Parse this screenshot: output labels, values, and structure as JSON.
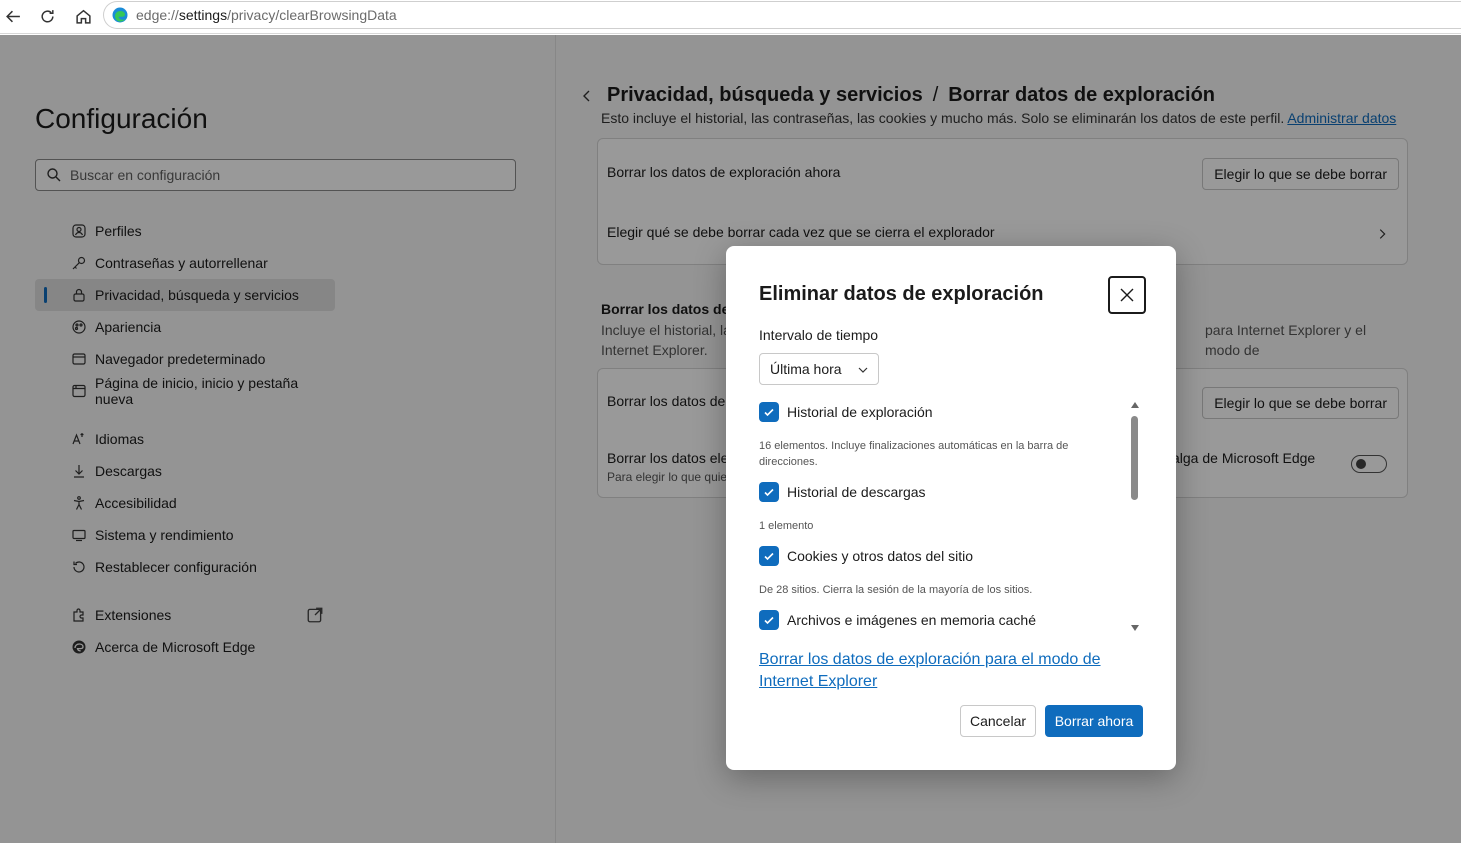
{
  "browser": {
    "url_prefix": "edge://",
    "url_host": "settings",
    "url_path": "/privacy/clearBrowsingData"
  },
  "sidebar": {
    "title": "Configuración",
    "search_placeholder": "Buscar en configuración",
    "items": [
      {
        "label": "Perfiles",
        "icon": "profile-icon"
      },
      {
        "label": "Contraseñas y autorrellenar",
        "icon": "key-icon"
      },
      {
        "label": "Privacidad, búsqueda y servicios",
        "icon": "lock-icon",
        "active": true
      },
      {
        "label": "Apariencia",
        "icon": "appearance-icon"
      },
      {
        "label": "Navegador predeterminado",
        "icon": "browser-icon"
      },
      {
        "label": "Página de inicio, inicio y pestaña nueva",
        "icon": "home-page-icon"
      },
      {
        "label": "Idiomas",
        "icon": "languages-icon"
      },
      {
        "label": "Descargas",
        "icon": "download-icon"
      },
      {
        "label": "Accesibilidad",
        "icon": "accessibility-icon"
      },
      {
        "label": "Sistema y rendimiento",
        "icon": "system-icon"
      },
      {
        "label": "Restablecer configuración",
        "icon": "reset-icon"
      },
      {
        "label": "Extensiones",
        "icon": "extensions-icon"
      },
      {
        "label": "Acerca de Microsoft Edge",
        "icon": "edge-icon"
      }
    ]
  },
  "main": {
    "breadcrumb_parent": "Privacidad, búsqueda y servicios",
    "breadcrumb_sep": "/",
    "breadcrumb_current": "Borrar datos de exploración",
    "description": "Esto incluye el historial, las contraseñas, las cookies y mucho más. Solo se eliminarán los datos de este perfil.",
    "manage_link": "Administrar datos",
    "card1_row1": "Borrar los datos de exploración ahora",
    "card1_button": "Elegir lo que se debe borrar",
    "card1_row2": "Elegir qué se debe borrar cada vez que se cierra el explorador",
    "section_title": "Borrar los datos de e",
    "section_desc_left": "Incluye el historial, la",
    "section_desc_right": "para Internet Explorer y el modo de",
    "section_desc_line2": "Internet Explorer.",
    "card2_row1": "Borrar los datos de",
    "card2_button": "Elegir lo que se debe borrar",
    "card2_row2_left": "Borrar los datos ele",
    "card2_row2_right": "alga de Microsoft Edge",
    "card2_row2_sub": "Para elegir lo que quier",
    "card2_toggle_on": false
  },
  "dialog": {
    "title": "Eliminar datos de exploración",
    "range_label": "Intervalo de tiempo",
    "range_value": "Última hora",
    "options": [
      {
        "label": "Historial de exploración",
        "checked": true,
        "desc": "16 elementos. Incluye finalizaciones automáticas en la barra de direcciones."
      },
      {
        "label": "Historial de descargas",
        "checked": true,
        "desc": "1 elemento"
      },
      {
        "label": "Cookies y otros datos del sitio",
        "checked": true,
        "desc": "De 28 sitios. Cierra la sesión de la mayoría de los sitios."
      },
      {
        "label": "Archivos e imágenes en memoria caché",
        "checked": true,
        "desc": ""
      }
    ],
    "ie_link": "Borrar los datos de exploración para el modo de Internet Explorer",
    "cancel_label": "Cancelar",
    "confirm_label": "Borrar ahora"
  },
  "colors": {
    "accent": "#0f6cbd",
    "overlay": "rgba(0,0,0,0.4)"
  }
}
